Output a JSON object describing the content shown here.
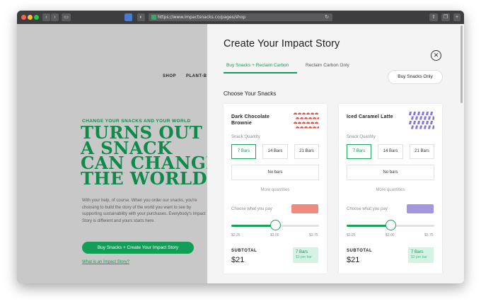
{
  "browser": {
    "url": "https://www.impactsnacks.co/pages/shop"
  },
  "site": {
    "nav": [
      "SHOP",
      "PLANT-B"
    ],
    "eyebrow": "CHANGE YOUR SNACKS AND YOUR WORLD",
    "headline": [
      "TURNS OUT",
      "A SNACK",
      "CAN CHANGE",
      "THE WORLD"
    ],
    "body": "With your help, of course. When you order our snacks, you're choosing to build the story of the world you want to see by supporting sustainability with your purchases. Everybody's Impact Story is different and yours starts here.",
    "cta": "Buy Snacks + Create Your Impact Story",
    "link": "What is an Impact Story?"
  },
  "panel": {
    "title": "Create Your Impact Story",
    "close_icon": "close-icon",
    "tabs": [
      {
        "label": "Buy Snacks + Reclaim Carbon",
        "active": true
      },
      {
        "label": "Reclaim Carbon Only",
        "active": false
      }
    ],
    "buy_only_label": "Buy Snacks Only",
    "section_title": "Choose Your Snacks",
    "cards": [
      {
        "name": "Dark Chocolate Brownie",
        "art_color": "#e0524b",
        "quantity_label": "Snack Quantity",
        "quantities": [
          "7 Bars",
          "14 Bars",
          "21 Bars"
        ],
        "selected_quantity": "7 Bars",
        "no_bars": "No bars",
        "more": "More quantities",
        "pay_label": "Choose what you pay",
        "bar_color": "#ef8a80",
        "ticks": [
          "$2.25",
          "$3.00",
          "$3.75"
        ],
        "slider_value": 3.0,
        "slider_min": 2.25,
        "slider_max": 3.75,
        "subtotal_label": "SUBTOTAL",
        "subtotal": "$21",
        "badge_qty": "7 Bars",
        "badge_price": "$3 per bar"
      },
      {
        "name": "Iced Caramel Latte",
        "art_color": "#8a76d6",
        "quantity_label": "Snack Quantity",
        "quantities": [
          "7 Bars",
          "14 Bars",
          "21 Bars"
        ],
        "selected_quantity": "7 Bars",
        "no_bars": "No bars",
        "more": "More quantities",
        "pay_label": "Choose what you pay",
        "bar_color": "#a596e0",
        "ticks": [
          "$2.25",
          "$3.00",
          "$3.75"
        ],
        "slider_value": 3.0,
        "slider_min": 2.25,
        "slider_max": 3.75,
        "subtotal_label": "SUBTOTAL",
        "subtotal": "$21",
        "badge_qty": "7 Bars",
        "badge_price": "$3 per bar"
      }
    ]
  },
  "colors": {
    "brand_green": "#139e57",
    "badge_bg": "#d4f3e4"
  }
}
